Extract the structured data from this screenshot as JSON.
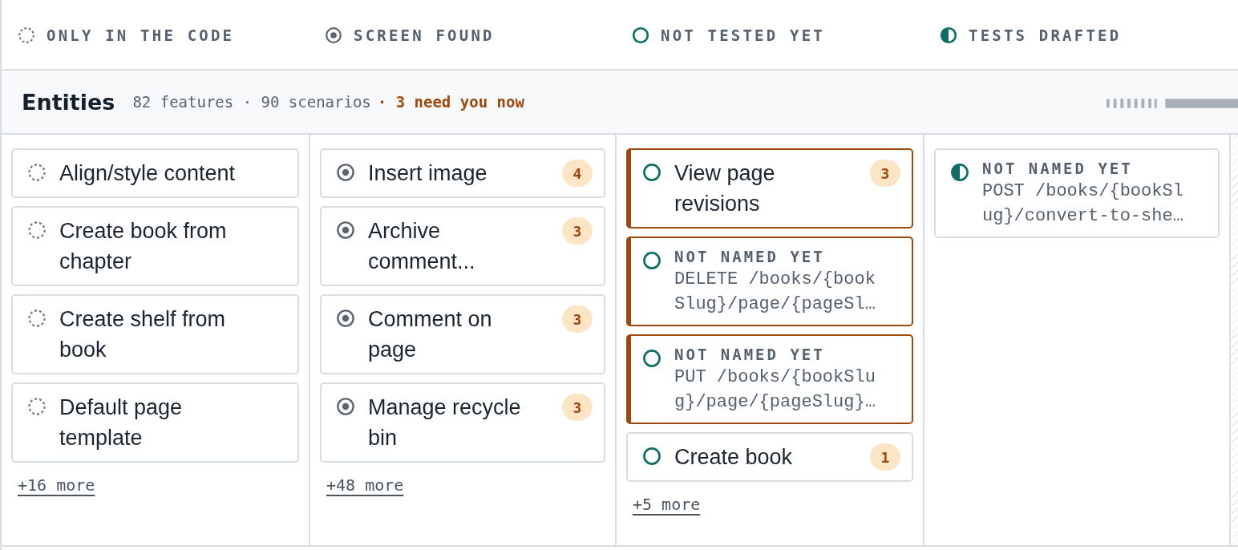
{
  "legend": [
    {
      "kind": "code",
      "label": "ONLY IN THE CODE"
    },
    {
      "kind": "screen",
      "label": "SCREEN FOUND"
    },
    {
      "kind": "untested",
      "label": "NOT TESTED YET"
    },
    {
      "kind": "drafted",
      "label": "TESTS DRAFTED"
    }
  ],
  "group": {
    "title": "Entities",
    "stats": "82 features · 90 scenarios",
    "attention": "· 3 need you now"
  },
  "columns": [
    {
      "cards": [
        {
          "kind": "code",
          "title": "Align/style content",
          "needs_you": false
        },
        {
          "kind": "code",
          "title": "Create book from chapter",
          "needs_you": false
        },
        {
          "kind": "code",
          "title": "Create shelf from book",
          "needs_you": false
        },
        {
          "kind": "code",
          "title": "Default page template",
          "needs_you": false
        }
      ],
      "more": "+16 more"
    },
    {
      "cards": [
        {
          "kind": "screen",
          "title": "Insert image",
          "badge": "4",
          "needs_you": false
        },
        {
          "kind": "screen",
          "title": "Archive comment...",
          "badge": "3",
          "needs_you": false
        },
        {
          "kind": "screen",
          "title": "Comment on page",
          "badge": "3",
          "needs_you": false
        },
        {
          "kind": "screen",
          "title": "Manage recycle bin",
          "badge": "3",
          "needs_you": false
        }
      ],
      "more": "+48 more"
    },
    {
      "cards": [
        {
          "kind": "untested",
          "title": "View page revisions",
          "badge": "3",
          "needs_you": true
        },
        {
          "kind": "untested",
          "unnamed": "NOT NAMED YET",
          "endpoint": "DELETE /books/{bookSlug}/page/{pageSl…",
          "needs_you": true
        },
        {
          "kind": "untested",
          "unnamed": "NOT NAMED YET",
          "endpoint": "PUT /books/{bookSlug}/page/{pageSlug}…",
          "needs_you": true
        },
        {
          "kind": "untested",
          "title": "Create book",
          "badge": "1",
          "needs_you": false
        }
      ],
      "more": "+5 more"
    },
    {
      "cards": [
        {
          "kind": "drafted",
          "unnamed": "NOT NAMED YET",
          "endpoint": "POST /books/{bookSlug}/convert-to-she…",
          "needs_you": false
        }
      ]
    }
  ]
}
